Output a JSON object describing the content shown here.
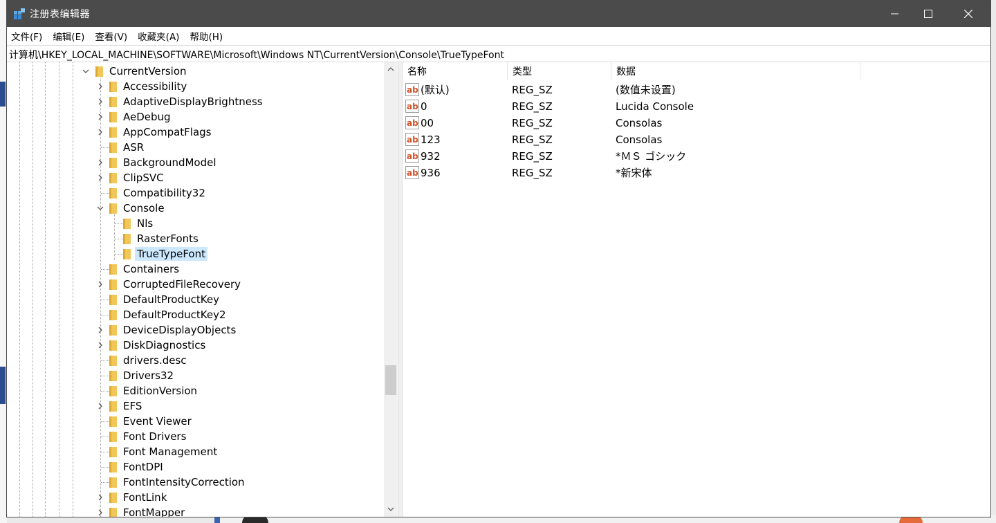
{
  "window": {
    "title": "注册表编辑器",
    "minimize_glyph": "—",
    "maximize_glyph": "☐",
    "close_glyph": "✕"
  },
  "menu": [
    {
      "label": "文件(F)"
    },
    {
      "label": "编辑(E)"
    },
    {
      "label": "查看(V)"
    },
    {
      "label": "收藏夹(A)"
    },
    {
      "label": "帮助(H)"
    }
  ],
  "address": "计算机\\HKEY_LOCAL_MACHINE\\SOFTWARE\\Microsoft\\Windows NT\\CurrentVersion\\Console\\TrueTypeFont",
  "tree": {
    "items": [
      {
        "label": "CurrentVersion",
        "level": 0,
        "expander": "expanded"
      },
      {
        "label": "Accessibility",
        "level": 1,
        "expander": "collapsed"
      },
      {
        "label": "AdaptiveDisplayBrightness",
        "level": 1,
        "expander": "collapsed"
      },
      {
        "label": "AeDebug",
        "level": 1,
        "expander": "collapsed"
      },
      {
        "label": "AppCompatFlags",
        "level": 1,
        "expander": "collapsed"
      },
      {
        "label": "ASR",
        "level": 1,
        "expander": "none"
      },
      {
        "label": "BackgroundModel",
        "level": 1,
        "expander": "collapsed"
      },
      {
        "label": "ClipSVC",
        "level": 1,
        "expander": "collapsed"
      },
      {
        "label": "Compatibility32",
        "level": 1,
        "expander": "none"
      },
      {
        "label": "Console",
        "level": 1,
        "expander": "expanded"
      },
      {
        "label": "Nls",
        "level": 2,
        "expander": "none"
      },
      {
        "label": "RasterFonts",
        "level": 2,
        "expander": "none"
      },
      {
        "label": "TrueTypeFont",
        "level": 2,
        "expander": "none",
        "selected": true
      },
      {
        "label": "Containers",
        "level": 1,
        "expander": "none"
      },
      {
        "label": "CorruptedFileRecovery",
        "level": 1,
        "expander": "collapsed"
      },
      {
        "label": "DefaultProductKey",
        "level": 1,
        "expander": "none"
      },
      {
        "label": "DefaultProductKey2",
        "level": 1,
        "expander": "none"
      },
      {
        "label": "DeviceDisplayObjects",
        "level": 1,
        "expander": "collapsed"
      },
      {
        "label": "DiskDiagnostics",
        "level": 1,
        "expander": "collapsed"
      },
      {
        "label": "drivers.desc",
        "level": 1,
        "expander": "none"
      },
      {
        "label": "Drivers32",
        "level": 1,
        "expander": "none"
      },
      {
        "label": "EditionVersion",
        "level": 1,
        "expander": "none"
      },
      {
        "label": "EFS",
        "level": 1,
        "expander": "collapsed"
      },
      {
        "label": "Event Viewer",
        "level": 1,
        "expander": "none"
      },
      {
        "label": "Font Drivers",
        "level": 1,
        "expander": "none"
      },
      {
        "label": "Font Management",
        "level": 1,
        "expander": "none"
      },
      {
        "label": "FontDPI",
        "level": 1,
        "expander": "none"
      },
      {
        "label": "FontIntensityCorrection",
        "level": 1,
        "expander": "none"
      },
      {
        "label": "FontLink",
        "level": 1,
        "expander": "collapsed"
      },
      {
        "label": "FontMapper",
        "level": 1,
        "expander": "collapsed"
      }
    ]
  },
  "list": {
    "columns": [
      {
        "label": "名称"
      },
      {
        "label": "类型"
      },
      {
        "label": "数据"
      }
    ],
    "rows": [
      {
        "name": "(默认)",
        "type": "REG_SZ",
        "data": "(数值未设置)",
        "icon": "string-value-icon"
      },
      {
        "name": "0",
        "type": "REG_SZ",
        "data": "Lucida Console",
        "icon": "string-value-icon"
      },
      {
        "name": "00",
        "type": "REG_SZ",
        "data": "Consolas",
        "icon": "string-value-icon"
      },
      {
        "name": "123",
        "type": "REG_SZ",
        "data": "Consolas",
        "icon": "string-value-icon"
      },
      {
        "name": "932",
        "type": "REG_SZ",
        "data": "*ＭＳ ゴシック",
        "icon": "string-value-icon"
      },
      {
        "name": "936",
        "type": "REG_SZ",
        "data": "*新宋体",
        "icon": "string-value-icon"
      }
    ]
  },
  "colors": {
    "titlebar": "#4b4b4b",
    "selection": "#cce8ff",
    "folder": "#f2c75a",
    "ab_icon": "#d0542b"
  }
}
